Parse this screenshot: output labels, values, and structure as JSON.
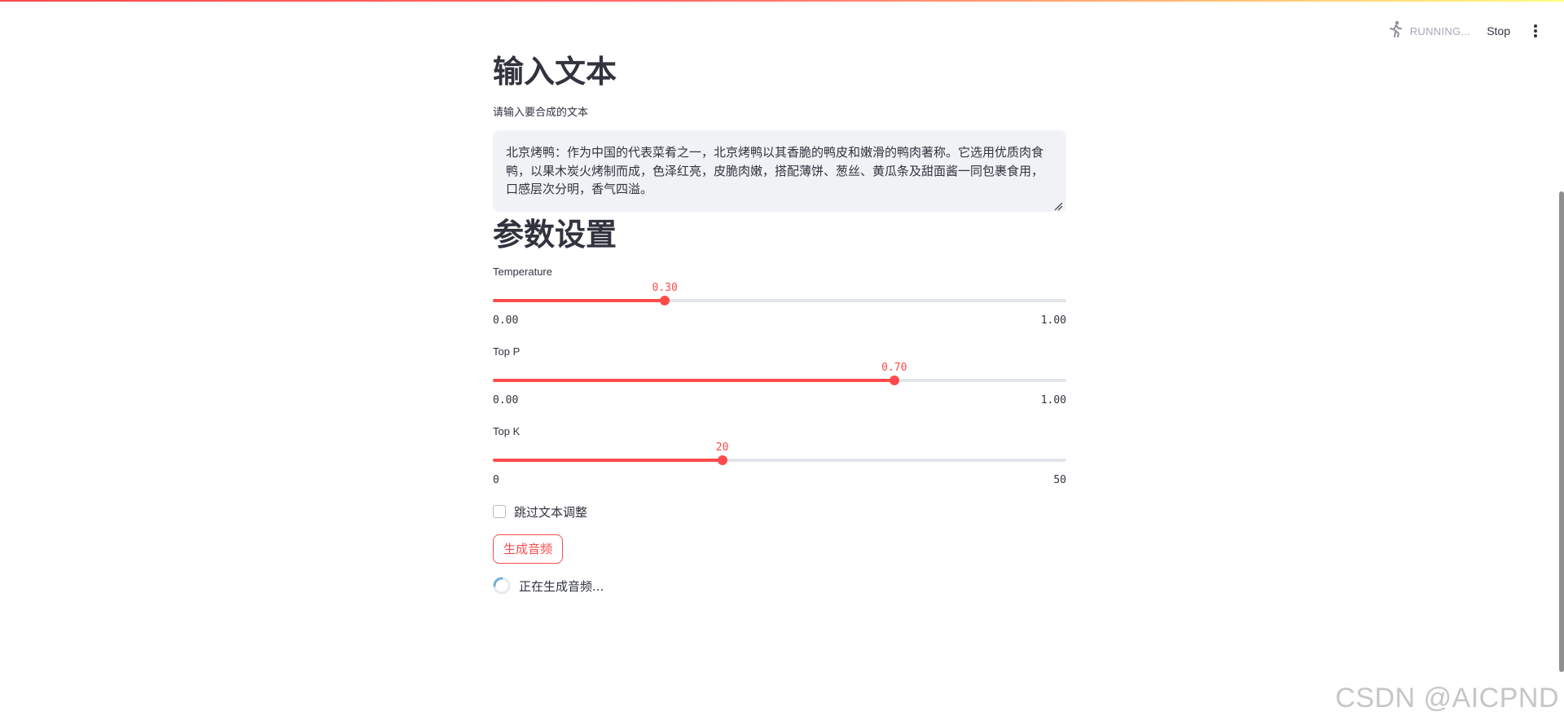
{
  "header": {
    "status_text": "RUNNING...",
    "stop_label": "Stop"
  },
  "input_section": {
    "title": "输入文本",
    "textarea_label": "请输入要合成的文本",
    "textarea_value": "北京烤鸭：作为中国的代表菜肴之一，北京烤鸭以其香脆的鸭皮和嫩滑的鸭肉著称。它选用优质肉食鸭，以果木炭火烤制而成，色泽红亮，皮脆肉嫩，搭配薄饼、葱丝、黄瓜条及甜面酱一同包裹食用，口感层次分明，香气四溢。"
  },
  "params_section": {
    "title": "参数设置",
    "sliders": [
      {
        "label": "Temperature",
        "value": 0.3,
        "display": "0.30",
        "min": 0.0,
        "max": 1.0,
        "min_label": "0.00",
        "max_label": "1.00"
      },
      {
        "label": "Top P",
        "value": 0.7,
        "display": "0.70",
        "min": 0.0,
        "max": 1.0,
        "min_label": "0.00",
        "max_label": "1.00"
      },
      {
        "label": "Top K",
        "value": 20,
        "display": "20",
        "min": 0,
        "max": 50,
        "min_label": "0",
        "max_label": "50"
      }
    ],
    "checkbox_label": "跳过文本调整",
    "checkbox_checked": false,
    "generate_button_label": "生成音频",
    "status_message": "正在生成音频..."
  },
  "watermark": "CSDN @AICPND",
  "colors": {
    "accent": "#ff4b4b",
    "text": "#31333f",
    "muted": "#a3a8b4",
    "input_bg": "#f0f2f6",
    "track": "#e2e5ea"
  },
  "icons": {
    "running": "running-man-icon",
    "menu": "kebab-menu-icon",
    "spinner": "spinner-icon",
    "resize": "resize-handle-icon"
  }
}
